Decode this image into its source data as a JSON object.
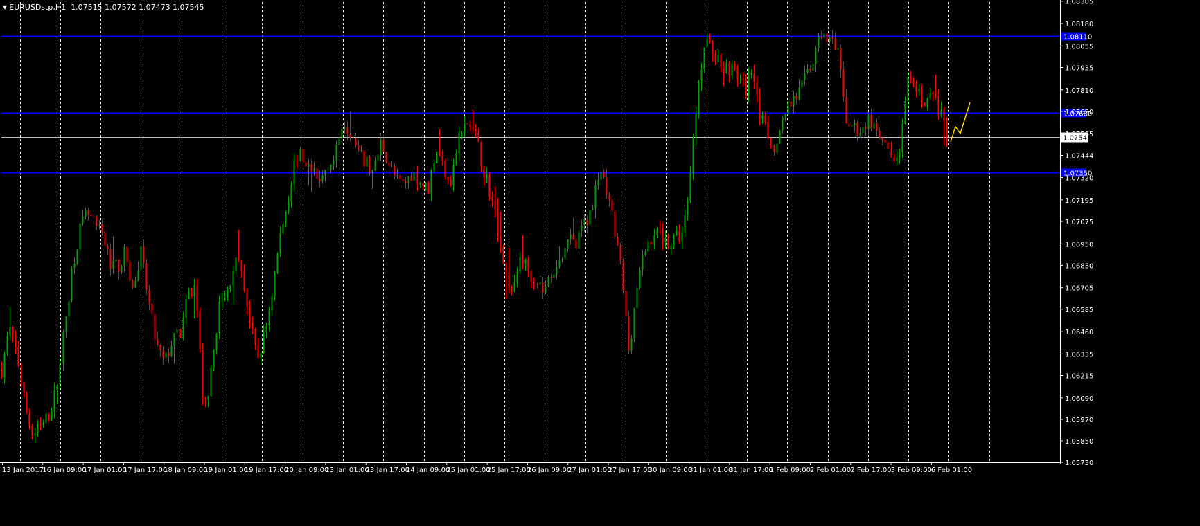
{
  "header": {
    "symbol_timeframe": "EURUSDstp,H1",
    "ohlc": "1.07515 1.07572 1.07473 1.07545"
  },
  "colors": {
    "background": "#000000",
    "grid": "#ffffff",
    "bull_candle": "#00a000",
    "bear_candle": "#ff0000",
    "level_line": "#0000ff",
    "price_line": "#c0c0c0",
    "projection": "#ffd700",
    "axis_text": "#ffffff"
  },
  "chart_data": {
    "type": "candlestick",
    "instrument": "EURUSDstp",
    "timeframe": "H1",
    "last_price": 1.07545,
    "ylim": [
      1.0573,
      1.083
    ],
    "y_ticks": [
      "1.08305",
      "1.08180",
      "1.08055",
      "1.07935",
      "1.07810",
      "1.07690",
      "1.07565",
      "1.07444",
      "1.07320",
      "1.07195",
      "1.07075",
      "1.06950",
      "1.06830",
      "1.06705",
      "1.06585",
      "1.06460",
      "1.06335",
      "1.06215",
      "1.06090",
      "1.05970",
      "1.05850",
      "1.05730"
    ],
    "current_price_label": "1.07545",
    "horizontal_levels": [
      {
        "price": 1.0811,
        "label": "1.08110"
      },
      {
        "price": 1.0768,
        "label": "1.07680"
      },
      {
        "price": 1.0735,
        "label": "1.07350"
      }
    ],
    "x_labels": [
      "13 Jan 2017",
      "16 Jan 09:00",
      "17 Jan 01:00",
      "17 Jan 17:00",
      "18 Jan 09:00",
      "19 Jan 01:00",
      "19 Jan 17:00",
      "20 Jan 09:00",
      "23 Jan 01:00",
      "23 Jan 17:00",
      "24 Jan 09:00",
      "25 Jan 01:00",
      "25 Jan 17:00",
      "26 Jan 09:00",
      "27 Jan 01:00",
      "27 Jan 17:00",
      "30 Jan 09:00",
      "31 Jan 01:00",
      "31 Jan 17:00",
      "1 Feb 09:00",
      "2 Feb 01:00",
      "2 Feb 17:00",
      "3 Feb 09:00",
      "6 Feb 01:00"
    ],
    "grid": "vertical-dashed",
    "price_path": [
      [
        0,
        1.0625
      ],
      [
        2,
        1.0648
      ],
      [
        4,
        1.0633
      ],
      [
        6,
        1.0605
      ],
      [
        8,
        1.0588
      ],
      [
        10,
        1.0592
      ],
      [
        12,
        1.0598
      ],
      [
        14,
        1.0612
      ],
      [
        16,
        1.0645
      ],
      [
        18,
        1.068
      ],
      [
        20,
        1.0702
      ],
      [
        22,
        1.0712
      ],
      [
        24,
        1.0705
      ],
      [
        26,
        1.07
      ],
      [
        28,
        1.0685
      ],
      [
        30,
        1.0682
      ],
      [
        32,
        1.069
      ],
      [
        34,
        1.0668
      ],
      [
        36,
        1.069
      ],
      [
        38,
        1.0662
      ],
      [
        40,
        1.0638
      ],
      [
        42,
        1.0628
      ],
      [
        44,
        1.064
      ],
      [
        46,
        1.0645
      ],
      [
        48,
        1.0665
      ],
      [
        50,
        1.0672
      ],
      [
        52,
        1.06
      ],
      [
        54,
        1.0622
      ],
      [
        56,
        1.066
      ],
      [
        58,
        1.0665
      ],
      [
        60,
        1.0685
      ],
      [
        62,
        1.068
      ],
      [
        64,
        1.0652
      ],
      [
        66,
        1.063
      ],
      [
        68,
        1.0645
      ],
      [
        70,
        1.067
      ],
      [
        72,
        1.07
      ],
      [
        74,
        1.072
      ],
      [
        76,
        1.0745
      ],
      [
        78,
        1.0742
      ],
      [
        80,
        1.0735
      ],
      [
        82,
        1.0728
      ],
      [
        84,
        1.074
      ],
      [
        86,
        1.0742
      ],
      [
        88,
        1.0765
      ],
      [
        90,
        1.0758
      ],
      [
        92,
        1.0745
      ],
      [
        94,
        1.074
      ],
      [
        96,
        1.0735
      ],
      [
        98,
        1.0752
      ],
      [
        100,
        1.074
      ],
      [
        102,
        1.073
      ],
      [
        104,
        1.0728
      ],
      [
        106,
        1.0735
      ],
      [
        108,
        1.073
      ],
      [
        110,
        1.0725
      ],
      [
        112,
        1.0748
      ],
      [
        114,
        1.0738
      ],
      [
        116,
        1.073
      ],
      [
        118,
        1.0755
      ],
      [
        120,
        1.0762
      ],
      [
        122,
        1.0758
      ],
      [
        124,
        1.074
      ],
      [
        126,
        1.0725
      ],
      [
        128,
        1.0705
      ],
      [
        130,
        1.068
      ],
      [
        132,
        1.0665
      ],
      [
        134,
        1.069
      ],
      [
        136,
        1.068
      ],
      [
        138,
        1.0675
      ],
      [
        140,
        1.0668
      ],
      [
        142,
        1.068
      ],
      [
        144,
        1.0685
      ],
      [
        146,
        1.07
      ],
      [
        148,
        1.0692
      ],
      [
        150,
        1.0705
      ],
      [
        152,
        1.0712
      ],
      [
        154,
        1.0735
      ],
      [
        156,
        1.0725
      ],
      [
        158,
        1.0705
      ],
      [
        160,
        1.068
      ],
      [
        162,
        1.0635
      ],
      [
        164,
        1.067
      ],
      [
        166,
        1.069
      ],
      [
        168,
        1.07
      ],
      [
        170,
        1.0702
      ],
      [
        172,
        1.0695
      ],
      [
        174,
        1.0698
      ],
      [
        176,
        1.0702
      ],
      [
        178,
        1.074
      ],
      [
        180,
        1.079
      ],
      [
        182,
        1.081
      ],
      [
        184,
        1.08
      ],
      [
        186,
        1.0795
      ],
      [
        188,
        1.0793
      ],
      [
        190,
        1.079
      ],
      [
        192,
        1.078
      ],
      [
        194,
        1.0795
      ],
      [
        196,
        1.0765
      ],
      [
        198,
        1.0755
      ],
      [
        200,
        1.0748
      ],
      [
        202,
        1.077
      ],
      [
        204,
        1.0775
      ],
      [
        206,
        1.078
      ],
      [
        208,
        1.079
      ],
      [
        210,
        1.08
      ],
      [
        212,
        1.0815
      ],
      [
        214,
        1.0808
      ],
      [
        216,
        1.08
      ],
      [
        218,
        1.0765
      ],
      [
        220,
        1.076
      ],
      [
        222,
        1.0758
      ],
      [
        224,
        1.0765
      ],
      [
        226,
        1.0755
      ],
      [
        228,
        1.075
      ],
      [
        230,
        1.0738
      ],
      [
        232,
        1.075
      ],
      [
        234,
        1.0785
      ],
      [
        236,
        1.078
      ],
      [
        238,
        1.0775
      ],
      [
        240,
        1.0778
      ],
      [
        242,
        1.077
      ],
      [
        244,
        1.0755
      ]
    ]
  },
  "projection_path": [
    [
      1372,
      205
    ],
    [
      1379,
      183
    ],
    [
      1386,
      193
    ],
    [
      1400,
      148
    ]
  ]
}
